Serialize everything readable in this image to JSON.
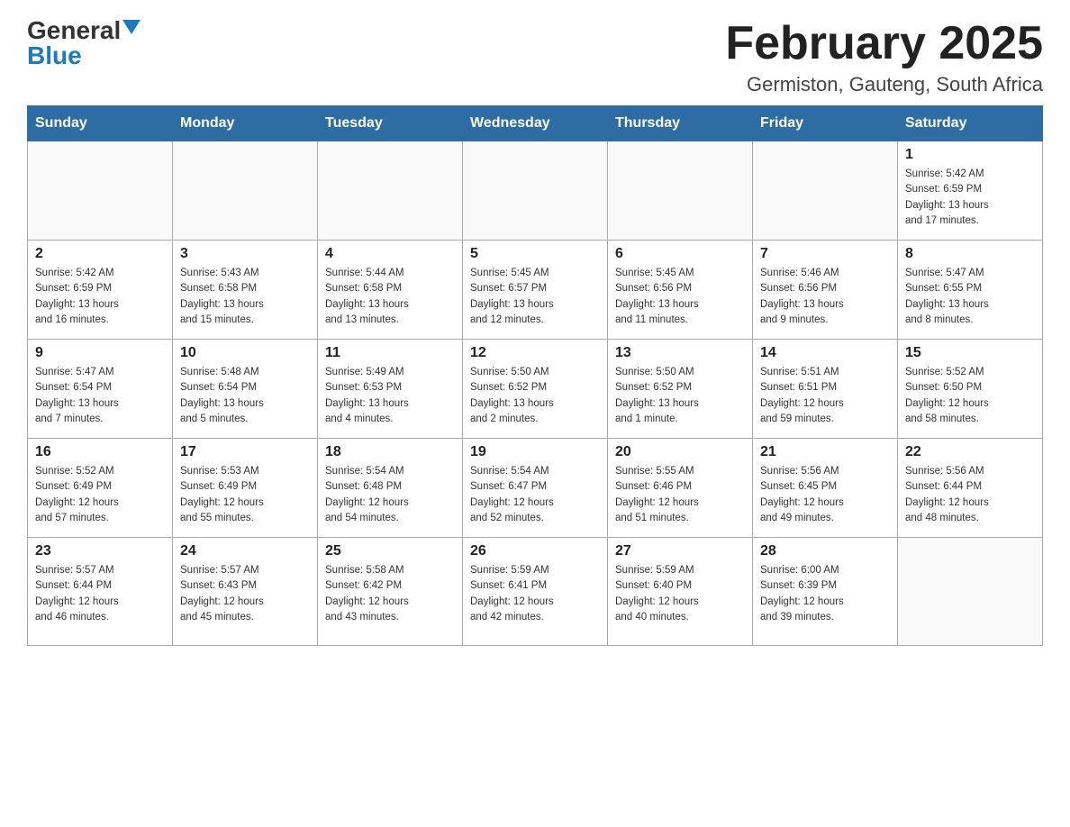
{
  "header": {
    "logo_general": "General",
    "logo_blue": "Blue",
    "month_title": "February 2025",
    "location": "Germiston, Gauteng, South Africa"
  },
  "weekdays": [
    "Sunday",
    "Monday",
    "Tuesday",
    "Wednesday",
    "Thursday",
    "Friday",
    "Saturday"
  ],
  "weeks": [
    [
      {
        "day": "",
        "info": ""
      },
      {
        "day": "",
        "info": ""
      },
      {
        "day": "",
        "info": ""
      },
      {
        "day": "",
        "info": ""
      },
      {
        "day": "",
        "info": ""
      },
      {
        "day": "",
        "info": ""
      },
      {
        "day": "1",
        "info": "Sunrise: 5:42 AM\nSunset: 6:59 PM\nDaylight: 13 hours\nand 17 minutes."
      }
    ],
    [
      {
        "day": "2",
        "info": "Sunrise: 5:42 AM\nSunset: 6:59 PM\nDaylight: 13 hours\nand 16 minutes."
      },
      {
        "day": "3",
        "info": "Sunrise: 5:43 AM\nSunset: 6:58 PM\nDaylight: 13 hours\nand 15 minutes."
      },
      {
        "day": "4",
        "info": "Sunrise: 5:44 AM\nSunset: 6:58 PM\nDaylight: 13 hours\nand 13 minutes."
      },
      {
        "day": "5",
        "info": "Sunrise: 5:45 AM\nSunset: 6:57 PM\nDaylight: 13 hours\nand 12 minutes."
      },
      {
        "day": "6",
        "info": "Sunrise: 5:45 AM\nSunset: 6:56 PM\nDaylight: 13 hours\nand 11 minutes."
      },
      {
        "day": "7",
        "info": "Sunrise: 5:46 AM\nSunset: 6:56 PM\nDaylight: 13 hours\nand 9 minutes."
      },
      {
        "day": "8",
        "info": "Sunrise: 5:47 AM\nSunset: 6:55 PM\nDaylight: 13 hours\nand 8 minutes."
      }
    ],
    [
      {
        "day": "9",
        "info": "Sunrise: 5:47 AM\nSunset: 6:54 PM\nDaylight: 13 hours\nand 7 minutes."
      },
      {
        "day": "10",
        "info": "Sunrise: 5:48 AM\nSunset: 6:54 PM\nDaylight: 13 hours\nand 5 minutes."
      },
      {
        "day": "11",
        "info": "Sunrise: 5:49 AM\nSunset: 6:53 PM\nDaylight: 13 hours\nand 4 minutes."
      },
      {
        "day": "12",
        "info": "Sunrise: 5:50 AM\nSunset: 6:52 PM\nDaylight: 13 hours\nand 2 minutes."
      },
      {
        "day": "13",
        "info": "Sunrise: 5:50 AM\nSunset: 6:52 PM\nDaylight: 13 hours\nand 1 minute."
      },
      {
        "day": "14",
        "info": "Sunrise: 5:51 AM\nSunset: 6:51 PM\nDaylight: 12 hours\nand 59 minutes."
      },
      {
        "day": "15",
        "info": "Sunrise: 5:52 AM\nSunset: 6:50 PM\nDaylight: 12 hours\nand 58 minutes."
      }
    ],
    [
      {
        "day": "16",
        "info": "Sunrise: 5:52 AM\nSunset: 6:49 PM\nDaylight: 12 hours\nand 57 minutes."
      },
      {
        "day": "17",
        "info": "Sunrise: 5:53 AM\nSunset: 6:49 PM\nDaylight: 12 hours\nand 55 minutes."
      },
      {
        "day": "18",
        "info": "Sunrise: 5:54 AM\nSunset: 6:48 PM\nDaylight: 12 hours\nand 54 minutes."
      },
      {
        "day": "19",
        "info": "Sunrise: 5:54 AM\nSunset: 6:47 PM\nDaylight: 12 hours\nand 52 minutes."
      },
      {
        "day": "20",
        "info": "Sunrise: 5:55 AM\nSunset: 6:46 PM\nDaylight: 12 hours\nand 51 minutes."
      },
      {
        "day": "21",
        "info": "Sunrise: 5:56 AM\nSunset: 6:45 PM\nDaylight: 12 hours\nand 49 minutes."
      },
      {
        "day": "22",
        "info": "Sunrise: 5:56 AM\nSunset: 6:44 PM\nDaylight: 12 hours\nand 48 minutes."
      }
    ],
    [
      {
        "day": "23",
        "info": "Sunrise: 5:57 AM\nSunset: 6:44 PM\nDaylight: 12 hours\nand 46 minutes."
      },
      {
        "day": "24",
        "info": "Sunrise: 5:57 AM\nSunset: 6:43 PM\nDaylight: 12 hours\nand 45 minutes."
      },
      {
        "day": "25",
        "info": "Sunrise: 5:58 AM\nSunset: 6:42 PM\nDaylight: 12 hours\nand 43 minutes."
      },
      {
        "day": "26",
        "info": "Sunrise: 5:59 AM\nSunset: 6:41 PM\nDaylight: 12 hours\nand 42 minutes."
      },
      {
        "day": "27",
        "info": "Sunrise: 5:59 AM\nSunset: 6:40 PM\nDaylight: 12 hours\nand 40 minutes."
      },
      {
        "day": "28",
        "info": "Sunrise: 6:00 AM\nSunset: 6:39 PM\nDaylight: 12 hours\nand 39 minutes."
      },
      {
        "day": "",
        "info": ""
      }
    ]
  ]
}
